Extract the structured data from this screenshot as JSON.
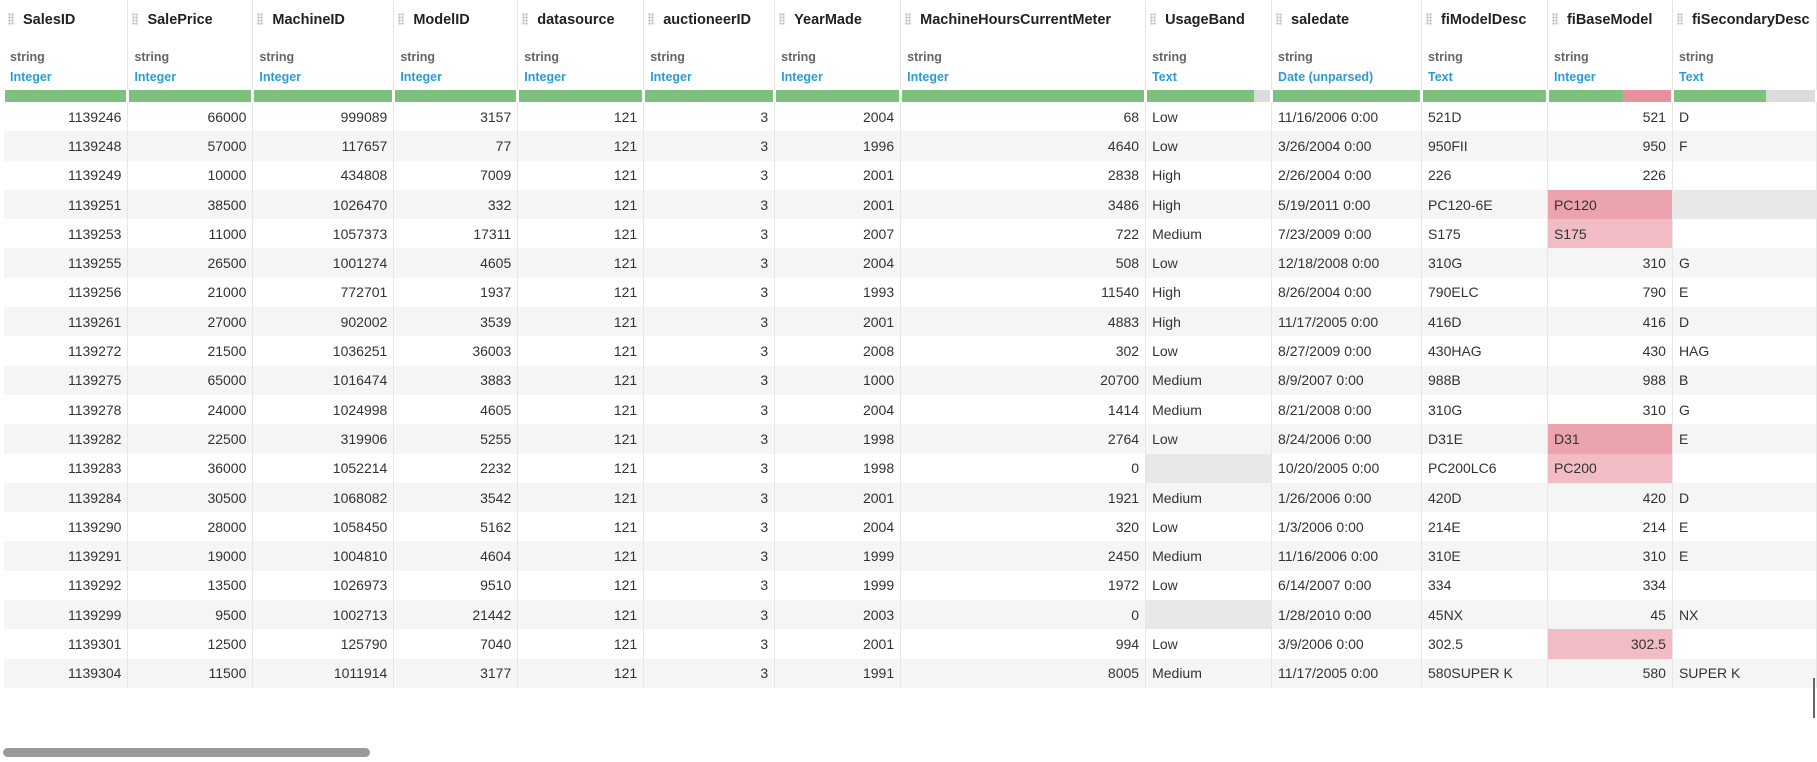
{
  "columns": [
    {
      "name": "SalesID",
      "storage": "string",
      "type": "Integer",
      "align": "num",
      "bar": {
        "ok": 100,
        "bad": 0,
        "empty": 0
      }
    },
    {
      "name": "SalePrice",
      "storage": "string",
      "type": "Integer",
      "align": "num",
      "bar": {
        "ok": 100,
        "bad": 0,
        "empty": 0
      }
    },
    {
      "name": "MachineID",
      "storage": "string",
      "type": "Integer",
      "align": "num",
      "bar": {
        "ok": 100,
        "bad": 0,
        "empty": 0
      }
    },
    {
      "name": "ModelID",
      "storage": "string",
      "type": "Integer",
      "align": "num",
      "bar": {
        "ok": 100,
        "bad": 0,
        "empty": 0
      }
    },
    {
      "name": "datasource",
      "storage": "string",
      "type": "Integer",
      "align": "num",
      "bar": {
        "ok": 100,
        "bad": 0,
        "empty": 0
      }
    },
    {
      "name": "auctioneerID",
      "storage": "string",
      "type": "Integer",
      "align": "num",
      "bar": {
        "ok": 100,
        "bad": 0,
        "empty": 0
      }
    },
    {
      "name": "YearMade",
      "storage": "string",
      "type": "Integer",
      "align": "num",
      "bar": {
        "ok": 100,
        "bad": 0,
        "empty": 0
      }
    },
    {
      "name": "MachineHoursCurrentMeter",
      "storage": "string",
      "type": "Integer",
      "align": "num",
      "bar": {
        "ok": 100,
        "bad": 0,
        "empty": 0
      }
    },
    {
      "name": "UsageBand",
      "storage": "string",
      "type": "Text",
      "align": "txt",
      "bar": {
        "ok": 87,
        "bad": 0,
        "empty": 13
      }
    },
    {
      "name": "saledate",
      "storage": "string",
      "type": "Date (unparsed)",
      "align": "txt",
      "bar": {
        "ok": 100,
        "bad": 0,
        "empty": 0
      }
    },
    {
      "name": "fiModelDesc",
      "storage": "string",
      "type": "Text",
      "align": "txt",
      "bar": {
        "ok": 100,
        "bad": 0,
        "empty": 0
      }
    },
    {
      "name": "fiBaseModel",
      "storage": "string",
      "type": "Integer",
      "align": "num",
      "bar": {
        "ok": 61,
        "bad": 39,
        "empty": 0
      }
    },
    {
      "name": "fiSecondaryDesc",
      "storage": "string",
      "type": "Text",
      "align": "txt",
      "bar": {
        "ok": 65,
        "bad": 0,
        "empty": 35
      }
    }
  ],
  "rows": [
    [
      "1139246",
      "66000",
      "999089",
      "3157",
      "121",
      "3",
      "2004",
      "68",
      "Low",
      "11/16/2006 0:00",
      "521D",
      "521",
      "D"
    ],
    [
      "1139248",
      "57000",
      "117657",
      "77",
      "121",
      "3",
      "1996",
      "4640",
      "Low",
      "3/26/2004 0:00",
      "950FII",
      "950",
      "F"
    ],
    [
      "1139249",
      "10000",
      "434808",
      "7009",
      "121",
      "3",
      "2001",
      "2838",
      "High",
      "2/26/2004 0:00",
      "226",
      "226",
      ""
    ],
    [
      "1139251",
      "38500",
      "1026470",
      "332",
      "121",
      "3",
      "2001",
      "3486",
      "High",
      "5/19/2011 0:00",
      "PC120-6E",
      "PC120",
      ""
    ],
    [
      "1139253",
      "11000",
      "1057373",
      "17311",
      "121",
      "3",
      "2007",
      "722",
      "Medium",
      "7/23/2009 0:00",
      "S175",
      "S175",
      ""
    ],
    [
      "1139255",
      "26500",
      "1001274",
      "4605",
      "121",
      "3",
      "2004",
      "508",
      "Low",
      "12/18/2008 0:00",
      "310G",
      "310",
      "G"
    ],
    [
      "1139256",
      "21000",
      "772701",
      "1937",
      "121",
      "3",
      "1993",
      "11540",
      "High",
      "8/26/2004 0:00",
      "790ELC",
      "790",
      "E"
    ],
    [
      "1139261",
      "27000",
      "902002",
      "3539",
      "121",
      "3",
      "2001",
      "4883",
      "High",
      "11/17/2005 0:00",
      "416D",
      "416",
      "D"
    ],
    [
      "1139272",
      "21500",
      "1036251",
      "36003",
      "121",
      "3",
      "2008",
      "302",
      "Low",
      "8/27/2009 0:00",
      "430HAG",
      "430",
      "HAG"
    ],
    [
      "1139275",
      "65000",
      "1016474",
      "3883",
      "121",
      "3",
      "1000",
      "20700",
      "Medium",
      "8/9/2007 0:00",
      "988B",
      "988",
      "B"
    ],
    [
      "1139278",
      "24000",
      "1024998",
      "4605",
      "121",
      "3",
      "2004",
      "1414",
      "Medium",
      "8/21/2008 0:00",
      "310G",
      "310",
      "G"
    ],
    [
      "1139282",
      "22500",
      "319906",
      "5255",
      "121",
      "3",
      "1998",
      "2764",
      "Low",
      "8/24/2006 0:00",
      "D31E",
      "D31",
      "E"
    ],
    [
      "1139283",
      "36000",
      "1052214",
      "2232",
      "121",
      "3",
      "1998",
      "0",
      "",
      "10/20/2005 0:00",
      "PC200LC6",
      "PC200",
      ""
    ],
    [
      "1139284",
      "30500",
      "1068082",
      "3542",
      "121",
      "3",
      "2001",
      "1921",
      "Medium",
      "1/26/2006 0:00",
      "420D",
      "420",
      "D"
    ],
    [
      "1139290",
      "28000",
      "1058450",
      "5162",
      "121",
      "3",
      "2004",
      "320",
      "Low",
      "1/3/2006 0:00",
      "214E",
      "214",
      "E"
    ],
    [
      "1139291",
      "19000",
      "1004810",
      "4604",
      "121",
      "3",
      "1999",
      "2450",
      "Medium",
      "11/16/2006 0:00",
      "310E",
      "310",
      "E"
    ],
    [
      "1139292",
      "13500",
      "1026973",
      "9510",
      "121",
      "3",
      "1999",
      "1972",
      "Low",
      "6/14/2007 0:00",
      "334",
      "334",
      ""
    ],
    [
      "1139299",
      "9500",
      "1002713",
      "21442",
      "121",
      "3",
      "2003",
      "0",
      "",
      "1/28/2010 0:00",
      "45NX",
      "45",
      "NX"
    ],
    [
      "1139301",
      "12500",
      "125790",
      "7040",
      "121",
      "3",
      "2001",
      "994",
      "Low",
      "3/9/2006 0:00",
      "302.5",
      "302.5",
      ""
    ],
    [
      "1139304",
      "11500",
      "1011914",
      "3177",
      "121",
      "3",
      "1991",
      "8005",
      "Medium",
      "11/17/2005 0:00",
      "580SUPER K",
      "580",
      "SUPER K"
    ]
  ],
  "cell_flags": {
    "3-11": "err",
    "4-11": "err soft",
    "11-11": "err",
    "12-11": "err soft",
    "18-11": "err soft",
    "12-8": "missing",
    "17-8": "missing",
    "3-12": "missing"
  },
  "colors": {
    "valid_bar": "#7ec07d",
    "invalid_bar": "#e8909c",
    "empty_bar": "#dcdcdc",
    "type_label": "#2e9bd6",
    "invalid_cell": "#eba3ae"
  }
}
